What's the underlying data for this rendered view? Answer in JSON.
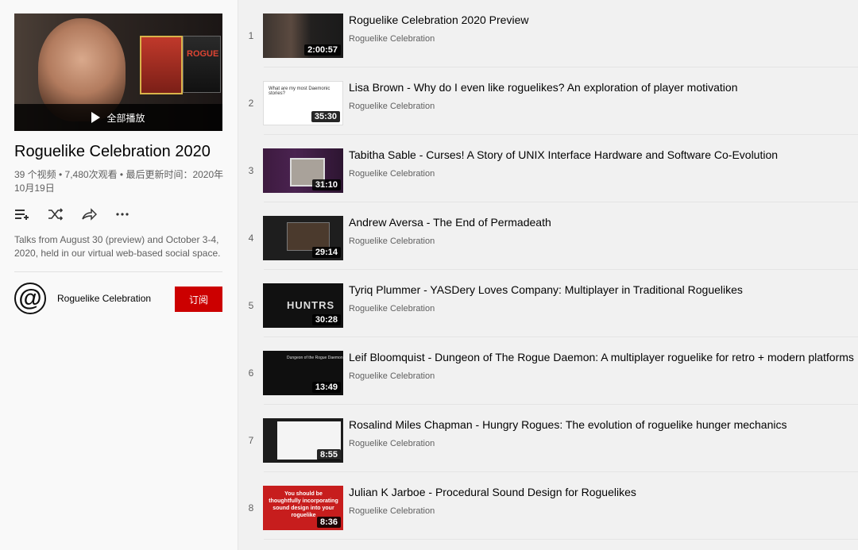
{
  "sidebar": {
    "play_all_label": "全部播放",
    "title": "Roguelike Celebration 2020",
    "meta": "39 个视频 • 7,480次观看 • 最后更新时间：2020年10月19日",
    "description": "Talks from August 30 (preview) and October 3-4, 2020, held in our virtual web-based social space.",
    "channel_name": "Roguelike Celebration",
    "subscribe_label": "订阅",
    "actions": [
      "add-to-queue-icon",
      "shuffle-icon",
      "share-icon",
      "more-icon"
    ]
  },
  "videos": [
    {
      "index": "1",
      "title": "Roguelike Celebration 2020 Preview",
      "channel": "Roguelike Celebration",
      "duration": "2:00:57"
    },
    {
      "index": "2",
      "title": "Lisa Brown - Why do I even like roguelikes? An exploration of player motivation",
      "channel": "Roguelike Celebration",
      "duration": "35:30"
    },
    {
      "index": "3",
      "title": "Tabitha Sable - Curses! A Story of UNIX Interface Hardware and Software Co-Evolution",
      "channel": "Roguelike Celebration",
      "duration": "31:10"
    },
    {
      "index": "4",
      "title": "Andrew Aversa - The End of Permadeath",
      "channel": "Roguelike Celebration",
      "duration": "29:14"
    },
    {
      "index": "5",
      "title": "Tyriq Plummer - YASDery Loves Company: Multiplayer in Traditional Roguelikes",
      "channel": "Roguelike Celebration",
      "duration": "30:28"
    },
    {
      "index": "6",
      "title": "Leif Bloomquist - Dungeon of The Rogue Daemon: A multiplayer roguelike for retro + modern platforms",
      "channel": "Roguelike Celebration",
      "duration": "13:49"
    },
    {
      "index": "7",
      "title": "Rosalind Miles Chapman - Hungry Rogues: The evolution of roguelike hunger mechanics",
      "channel": "Roguelike Celebration",
      "duration": "8:55"
    },
    {
      "index": "8",
      "title": "Julian K Jarboe - Procedural Sound Design for Roguelikes",
      "channel": "Roguelike Celebration",
      "duration": "8:36"
    }
  ],
  "thumb_text": {
    "t2": "What are my most Daemonic stories?",
    "t5": "HUNTRS",
    "t6": "Dungeon of the Rogue Daemon",
    "t8": "You should be thoughtfully incorporating sound design into your roguelike",
    "hero_box": "ROGUE"
  },
  "colors": {
    "subscribe": "#cc0000",
    "background": "#f1f1f1",
    "sidebar": "#f9f9f9"
  }
}
